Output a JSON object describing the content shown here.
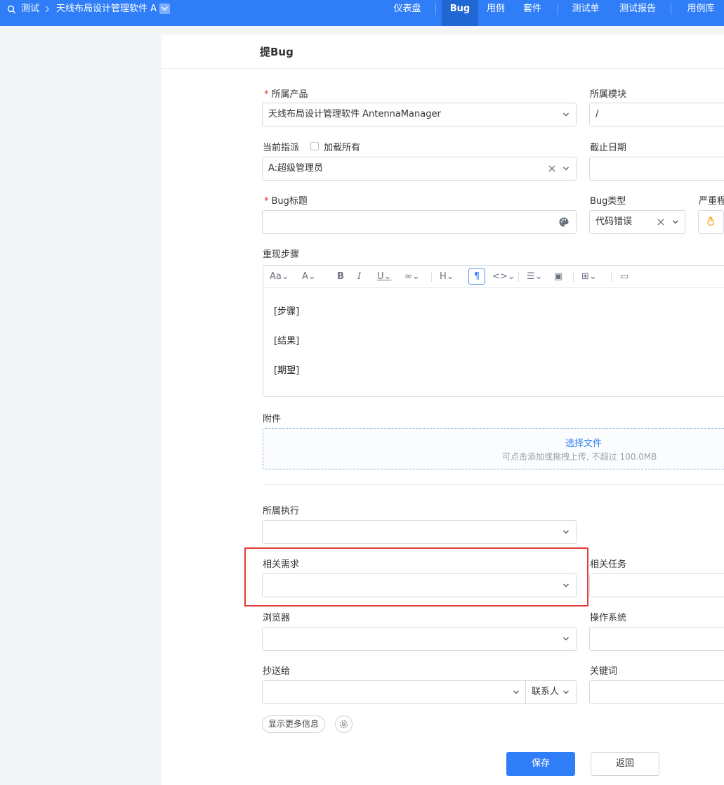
{
  "topbar": {
    "crumb_root": "测试",
    "crumb_product": "天线布局设计管理软件 A",
    "nav": [
      "仪表盘",
      "Bug",
      "用例",
      "套件",
      "测试单",
      "测试报告",
      "用例库"
    ]
  },
  "page": {
    "title": "提Bug"
  },
  "form": {
    "product_label": "所属产品",
    "product_value": "天线布局设计管理软件 AntennaManager",
    "module_label": "所属模块",
    "module_value": "/",
    "assign_label": "当前指派",
    "load_all_label": "加载所有",
    "assign_value": "A:超级管理员",
    "deadline_label": "截止日期",
    "title_label": "Bug标题",
    "type_label": "Bug类型",
    "type_value": "代码错误",
    "severity_label": "严重程",
    "severity_value": "3",
    "steps_label": "重现步骤",
    "steps_lines": [
      "[步骤]",
      "[结果]",
      "[期望]"
    ],
    "attachment_label": "附件",
    "upload_link": "选择文件",
    "upload_hint": "可点击添加或拖拽上传, 不超过 100.0MB",
    "execution_label": "所属执行",
    "story_label": "相关需求",
    "task_label": "相关任务",
    "browser_label": "浏览器",
    "os_label": "操作系统",
    "cc_label": "抄送给",
    "contacts_label": "联系人",
    "keywords_label": "关键词",
    "more_info_label": "显示更多信息",
    "save_label": "保存",
    "back_label": "返回"
  },
  "colors": {
    "primary": "#2f7ef7",
    "required": "#e23c39",
    "highlight": "#e53935"
  }
}
